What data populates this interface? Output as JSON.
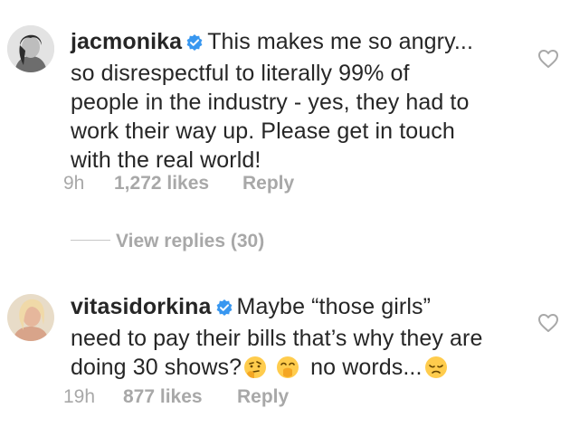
{
  "comments": [
    {
      "username": "jacmonika",
      "text": "This makes me so angry... so disrespectful to literally 99% of people in the industry - yes, they had to work their way up. Please get in touch with the real world!",
      "lines": [
        "This makes me so angry...",
        "so disrespectful to literally 99% of",
        "people in the industry - yes, they had to",
        "work their way up. Please get in touch",
        "with the real world!"
      ],
      "time": "9h",
      "likes": "1,272 likes",
      "reply": "Reply"
    },
    {
      "username": "vitasidorkina",
      "text": "Maybe “those girls” need to pay their bills that’s why they are doing 30 shows? no words...",
      "lines": [
        "Maybe “those girls”",
        "need to pay their bills that’s why they are",
        "doing 30 shows?",
        "no words..."
      ],
      "emojis": [
        "thinking-face-icon",
        "hand-over-mouth-face-icon",
        "disappointed-face-icon"
      ],
      "time": "19h",
      "likes": "877 likes",
      "reply": "Reply"
    }
  ],
  "view_replies": "View replies (30)",
  "colors": {
    "text": "#262626",
    "secondary": "#a8a8a8",
    "verified": "#3897f0",
    "emoji": "#ffcc4d"
  }
}
